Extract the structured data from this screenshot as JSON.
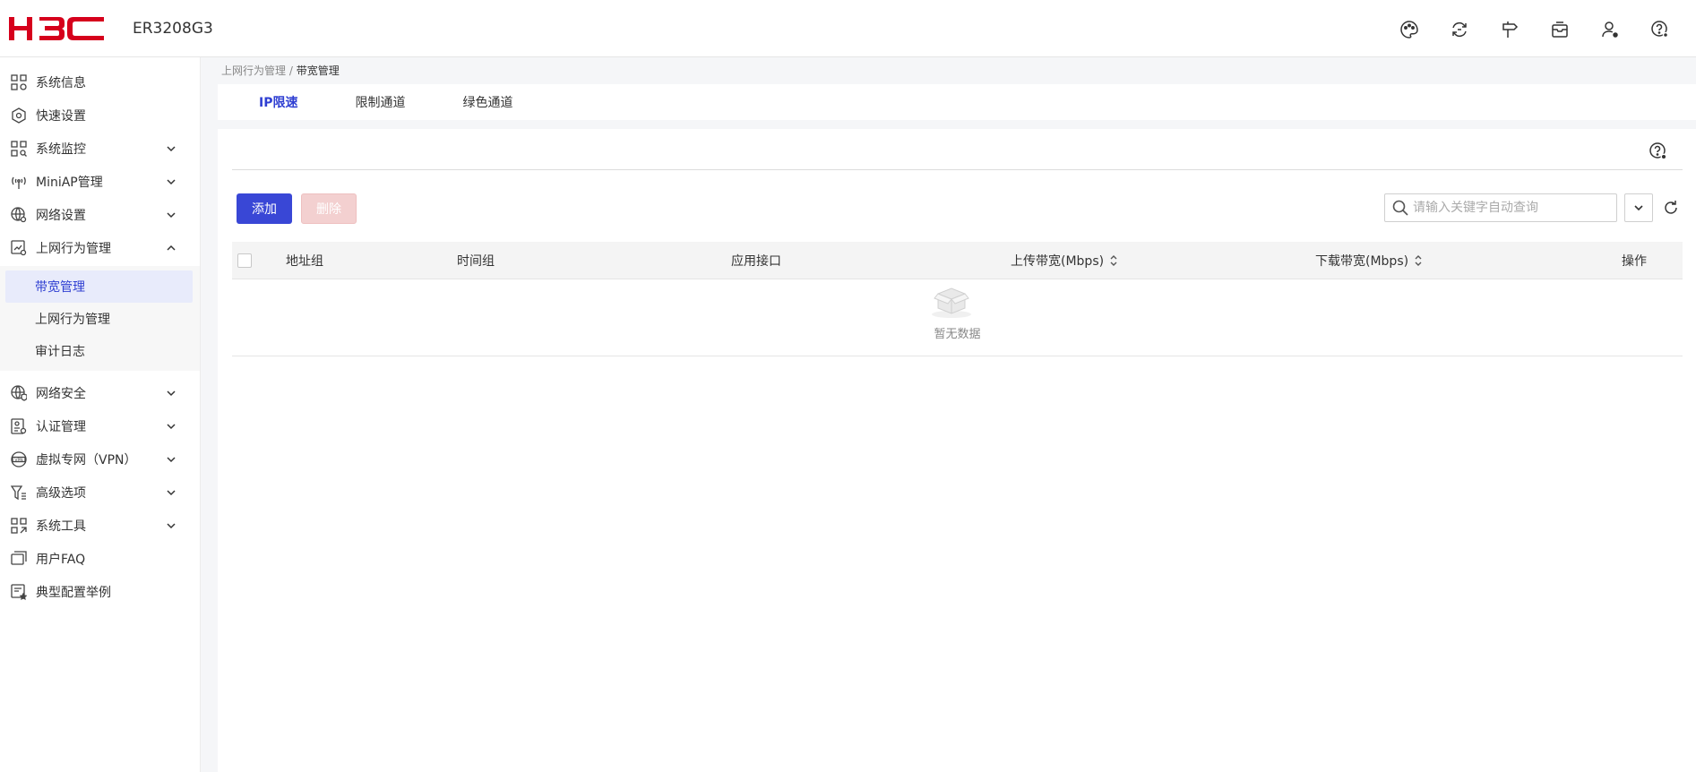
{
  "header": {
    "logo_text": "H3C",
    "model": "ER3208G3",
    "icons": [
      "palette-icon",
      "sync-icon",
      "signpost-icon",
      "mailbox-icon",
      "user-settings-icon",
      "help-settings-icon"
    ]
  },
  "sidebar": {
    "items": [
      {
        "label": "系统信息",
        "icon": "system-info-icon",
        "chevron": "none"
      },
      {
        "label": "快速设置",
        "icon": "quick-setup-icon",
        "chevron": "none"
      },
      {
        "label": "系统监控",
        "icon": "system-monitor-icon",
        "chevron": "down"
      },
      {
        "label": "MiniAP管理",
        "icon": "miniap-icon",
        "chevron": "down"
      },
      {
        "label": "网络设置",
        "icon": "network-settings-icon",
        "chevron": "down"
      },
      {
        "label": "上网行为管理",
        "icon": "behavior-management-icon",
        "chevron": "up"
      },
      {
        "label": "网络安全",
        "icon": "network-security-icon",
        "chevron": "down"
      },
      {
        "label": "认证管理",
        "icon": "auth-management-icon",
        "chevron": "down"
      },
      {
        "label": "虚拟专网（VPN）",
        "icon": "vpn-icon",
        "chevron": "down"
      },
      {
        "label": "高级选项",
        "icon": "advanced-options-icon",
        "chevron": "down"
      },
      {
        "label": "系统工具",
        "icon": "system-tools-icon",
        "chevron": "down"
      },
      {
        "label": "用户FAQ",
        "icon": "faq-icon",
        "chevron": "none"
      },
      {
        "label": "典型配置举例",
        "icon": "config-example-icon",
        "chevron": "none"
      }
    ],
    "submenu": [
      {
        "label": "带宽管理",
        "active": true
      },
      {
        "label": "上网行为管理",
        "active": false
      },
      {
        "label": "审计日志",
        "active": false
      }
    ]
  },
  "breadcrumb": {
    "parent": "上网行为管理",
    "separator": " / ",
    "current": "带宽管理"
  },
  "tabs": [
    {
      "label": "IP限速",
      "active": true
    },
    {
      "label": "限制通道",
      "active": false
    },
    {
      "label": "绿色通道",
      "active": false
    }
  ],
  "toolbar": {
    "add_label": "添加",
    "delete_label": "删除",
    "search_placeholder": "请输入关键字自动查询"
  },
  "table": {
    "columns": [
      "地址组",
      "时间组",
      "应用接口",
      "上传带宽(Mbps)",
      "下载带宽(Mbps)",
      "操作"
    ],
    "rows": [],
    "empty_text": "暂无数据"
  },
  "colors": {
    "accent": "#3947d6",
    "brand_red": "#d6001c",
    "delete_disabled": "#f3d0d0",
    "active_bg": "#e8ebfb"
  }
}
